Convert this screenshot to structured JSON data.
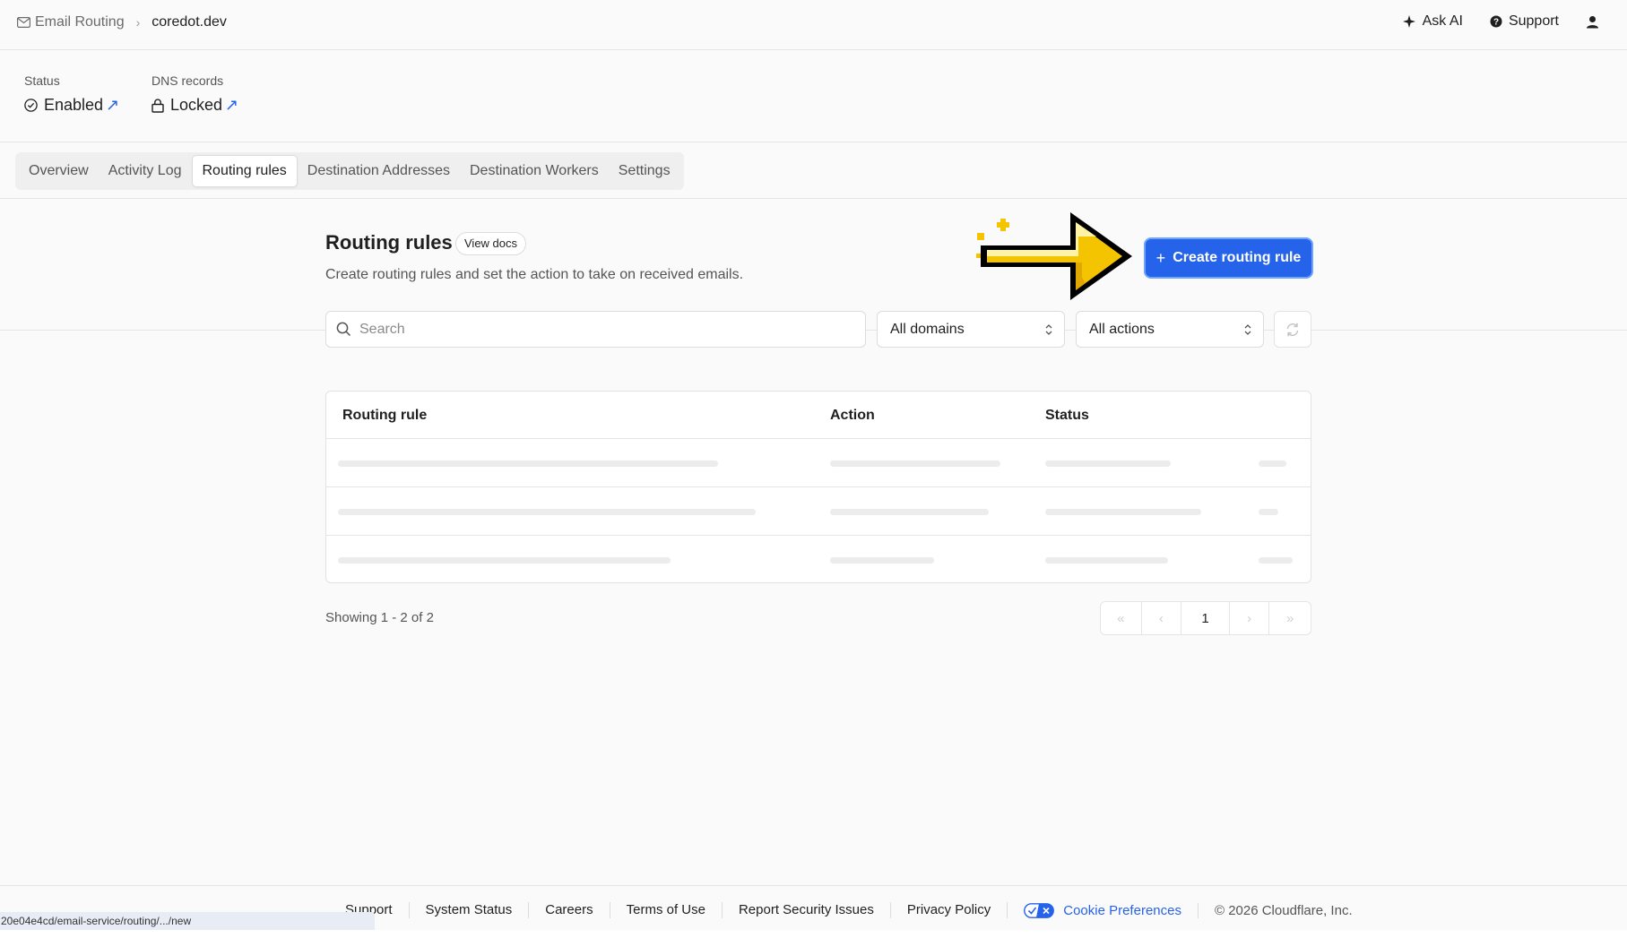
{
  "breadcrumb": {
    "parent": "Email Routing",
    "current": "coredot.dev"
  },
  "header_actions": {
    "ask_ai": "Ask AI",
    "support": "Support"
  },
  "status": {
    "status_label": "Status",
    "status_value": "Enabled",
    "dns_label": "DNS records",
    "dns_value": "Locked"
  },
  "tabs": [
    {
      "label": "Overview",
      "active": false
    },
    {
      "label": "Activity Log",
      "active": false
    },
    {
      "label": "Routing rules",
      "active": true
    },
    {
      "label": "Destination Addresses",
      "active": false
    },
    {
      "label": "Destination Workers",
      "active": false
    },
    {
      "label": "Settings",
      "active": false
    }
  ],
  "page": {
    "title": "Routing rules",
    "docs_button": "View docs",
    "description": "Create routing rules and set the action to take on received emails.",
    "create_button": "Create routing rule"
  },
  "filters": {
    "search_placeholder": "Search",
    "domains_selected": "All domains",
    "actions_selected": "All actions"
  },
  "table": {
    "columns": [
      "Routing rule",
      "Action",
      "Status"
    ],
    "loading_rows": 3
  },
  "pagination": {
    "showing": "Showing 1 - 2 of 2",
    "current_page": "1"
  },
  "footer": {
    "links": [
      "Support",
      "System Status",
      "Careers",
      "Terms of Use",
      "Report Security Issues",
      "Privacy Policy"
    ],
    "cookie_preferences": "Cookie Preferences",
    "copyright": "© 2026 Cloudflare, Inc."
  },
  "status_bar_url": "20e04e4cd/email-service/routing/.../new",
  "colors": {
    "accent": "#2563eb",
    "arrow": "#f5c400"
  }
}
